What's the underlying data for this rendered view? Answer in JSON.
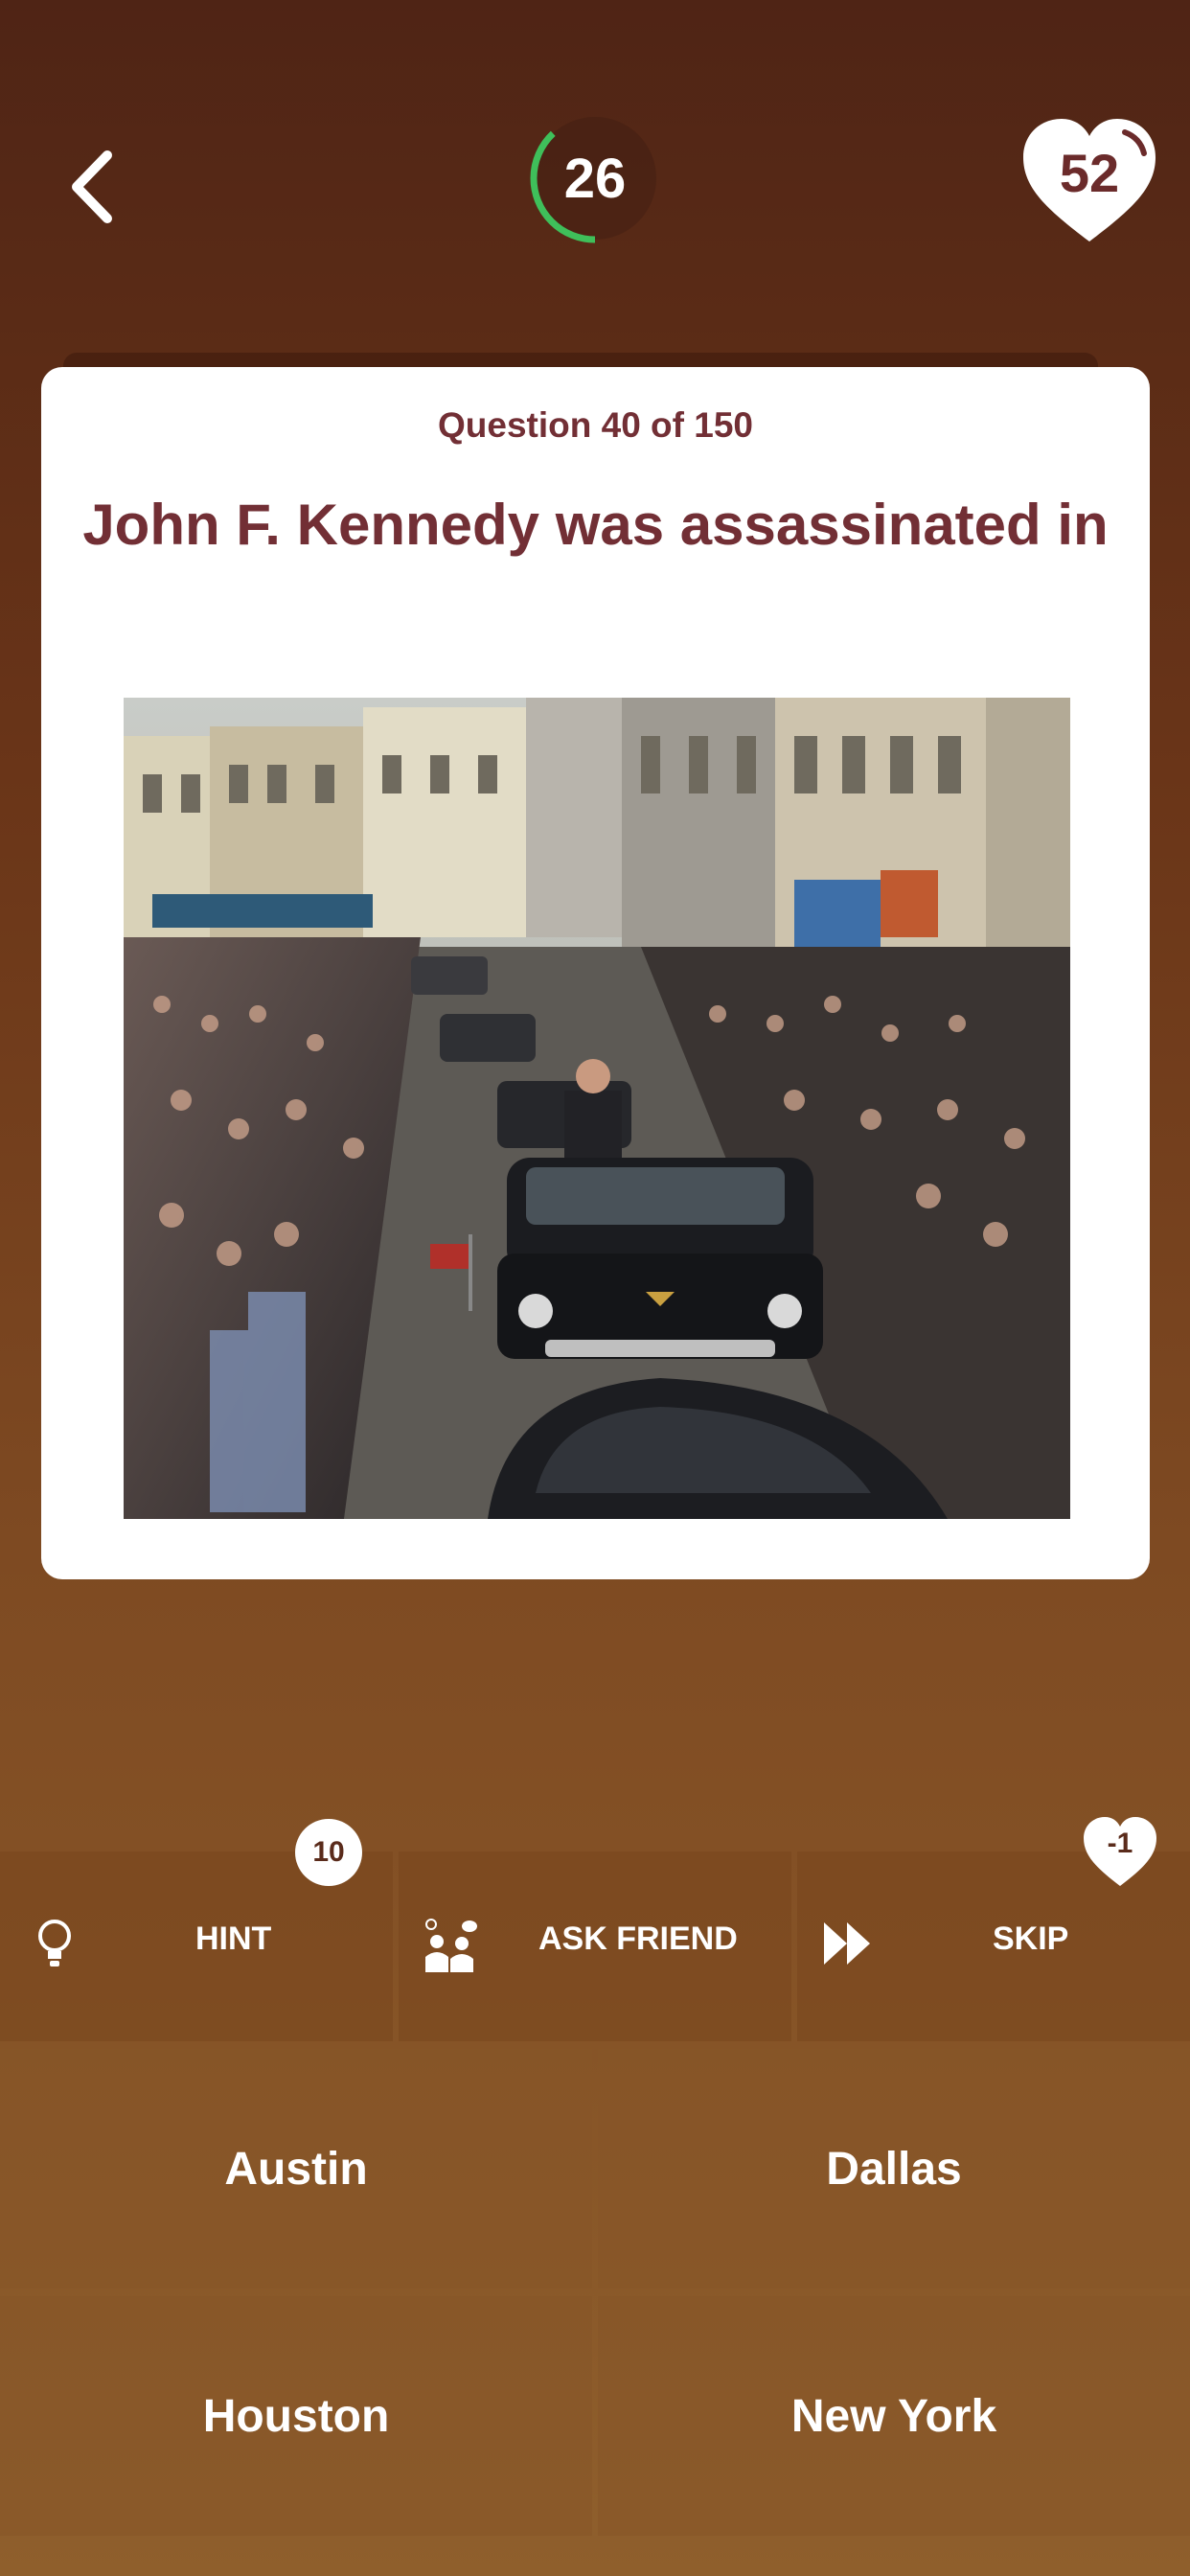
{
  "header": {
    "back_icon": "chevron-left-icon",
    "timer_value": "26",
    "timer_color": "#3fbf5a",
    "timer_progress": 0.38,
    "lives_value": "52",
    "lives_icon": "heart-icon"
  },
  "question": {
    "counter": "Question 40 of 150",
    "text": "John F. Kennedy was assassinated in",
    "image_label": "motorcade-photo"
  },
  "lifelines": {
    "hint": {
      "label": "HINT",
      "badge": "10",
      "icon": "lightbulb-icon"
    },
    "ask_friend": {
      "label": "ASK FRIEND",
      "icon": "people-chat-icon"
    },
    "skip": {
      "label": "SKIP",
      "badge": "-1",
      "icon": "fast-forward-icon"
    }
  },
  "answers": [
    {
      "label": "Austin"
    },
    {
      "label": "Dallas"
    },
    {
      "label": "Houston"
    },
    {
      "label": "New York"
    }
  ],
  "colors": {
    "accent_text": "#722f35",
    "background_top": "#4f2415",
    "background_bottom": "#8f5f2c"
  }
}
